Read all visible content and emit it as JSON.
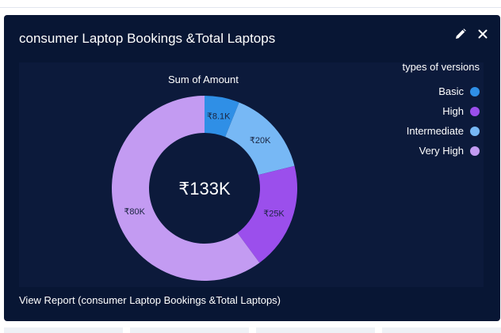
{
  "card": {
    "title": "consumer Laptop Bookings &Total Laptops",
    "footer_link": "View Report (consumer Laptop Bookings &Total Laptops)"
  },
  "colors": {
    "card_bg": "#081634",
    "plot_bg": "#0c1a3b",
    "Basic": "#2f8fe6",
    "High": "#9b4fec",
    "Intermediate": "#77b8f5",
    "Very High": "#c39bf2"
  },
  "chart_data": {
    "type": "pie",
    "variant": "donut",
    "title": "Sum of Amount",
    "total_label": "₹133K",
    "legend_title": "types of versions",
    "legend_position": "top-right",
    "categories": [
      "Basic",
      "Intermediate",
      "High",
      "Very High"
    ],
    "values": [
      8.1,
      20,
      25,
      80
    ],
    "value_labels": [
      "₹8.1K",
      "₹20K",
      "₹25K",
      "₹80K"
    ],
    "units": "₹K"
  },
  "legend": {
    "title": "types of versions",
    "items": [
      {
        "label": "Basic",
        "color": "#2f8fe6"
      },
      {
        "label": "High",
        "color": "#9b4fec"
      },
      {
        "label": "Intermediate",
        "color": "#77b8f5"
      },
      {
        "label": "Very High",
        "color": "#c39bf2"
      }
    ]
  }
}
